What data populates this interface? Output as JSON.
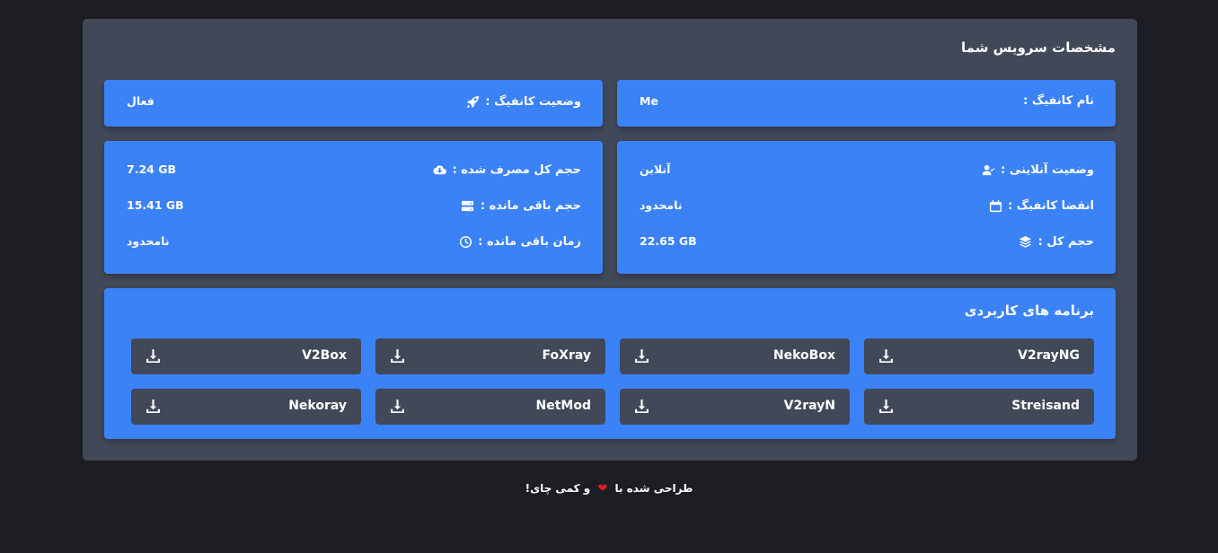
{
  "header": {
    "title": "مشخصات سرویس شما"
  },
  "config_box": {
    "config_name_label": "نام کانفیگ :",
    "config_name_value": "Me",
    "config_status_label": "وضعیت کانفیگ :",
    "config_status_value": "فعال"
  },
  "status_box": {
    "online_label": "وضعیت آنلاینی :",
    "online_value": "آنلاین",
    "expiry_label": "انقضا کانفیگ :",
    "expiry_value": "نامحدود",
    "total_label": "حجم کل :",
    "total_value": "22.65 GB"
  },
  "usage_box": {
    "used_label": "حجم کل مصرف شده :",
    "used_value": "7.24 GB",
    "remaining_label": "حجم باقی مانده :",
    "remaining_value": "15.41 GB",
    "time_label": "زمان باقی مانده :",
    "time_value": "نامحدود"
  },
  "apps": {
    "title": "برنامه های کاربردی",
    "items": [
      {
        "name": "V2rayNG"
      },
      {
        "name": "NekoBox"
      },
      {
        "name": "FoXray"
      },
      {
        "name": "V2Box"
      },
      {
        "name": "Streisand"
      },
      {
        "name": "V2rayN"
      },
      {
        "name": "NetMod"
      },
      {
        "name": "Nekoray"
      }
    ]
  },
  "footer": {
    "text_before": "طراحی شده با",
    "text_after": "و کمی چای!"
  },
  "colors": {
    "background": "#1d1e23",
    "card": "#414858",
    "accent": "#3b82f6",
    "heart": "#e11d2a"
  },
  "icons": {
    "config_status": "rocket-icon",
    "online": "user-check-icon",
    "expiry": "calendar-icon",
    "total": "layers-icon",
    "used": "cloud-download-icon",
    "remaining": "server-icon",
    "time": "clock-icon",
    "download": "download-icon"
  }
}
